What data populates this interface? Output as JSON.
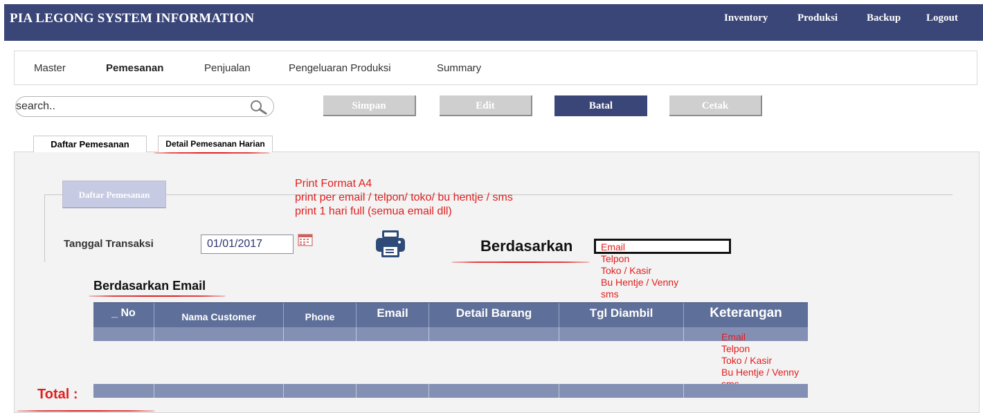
{
  "app": {
    "title": "PIA LEGONG SYSTEM INFORMATION",
    "topnav": [
      "Inventory",
      "Produksi",
      "Backup",
      "Logout"
    ]
  },
  "menu": {
    "items": [
      "Master",
      "Pemesanan",
      "Penjualan",
      "Pengeluaran Produksi",
      "Summary"
    ],
    "active": "Pemesanan"
  },
  "search": {
    "placeholder": "search.."
  },
  "toolbar": {
    "simpan": "Simpan",
    "edit": "Edit",
    "batal": "Batal",
    "cetak": "Cetak"
  },
  "tabs": [
    "Daftar Pemesanan",
    "Detail Pemesanan Harian"
  ],
  "panel": {
    "legend": "Daftar Pemesanan",
    "notes": [
      "Print Format A4",
      "print per email / telpon/ toko/ bu hentje / sms",
      "print 1 hari full (semua email dll)"
    ],
    "tanggal_label": "Tanggal Transaksi",
    "tanggal_value": "01/01/2017",
    "berdasarkan_label": "Berdasarkan",
    "berdasarkan_options": [
      "Email",
      "Telpon",
      "Toko / Kasir",
      "Bu Hentje / Venny",
      "sms"
    ],
    "section_title": "Berdasarkan Email",
    "total_label": "Total :"
  },
  "table": {
    "columns": [
      "_ No",
      "Nama Customer",
      "Phone",
      "Email",
      "Detail Barang",
      "Tgl Diambil",
      "Keterangan"
    ]
  },
  "keterangan_options": [
    "Email",
    "Telpon",
    "Toko / Kasir",
    "Bu Hentje / Venny",
    "sms"
  ],
  "colors": {
    "header_bg": "#3a4678",
    "table_header": "#5e6f99",
    "table_row": "#8390b4",
    "annotation_red": "#e01e1e",
    "disabled_button": "#cfcfcf"
  }
}
